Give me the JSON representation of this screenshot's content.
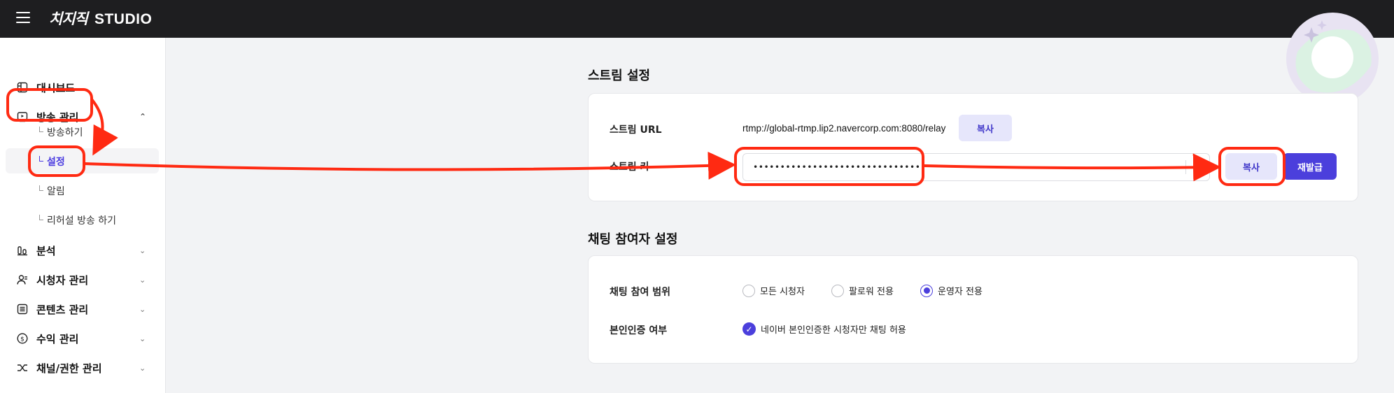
{
  "header": {
    "logo_mark": "치지직",
    "logo_text": "STUDIO"
  },
  "sidebar": {
    "dashboard": "대시보드",
    "broadcast": "방송 관리",
    "sub": [
      "방송하기",
      "설정",
      "알림",
      "리허설 방송 하기"
    ],
    "analytics": "분석",
    "viewers": "시청자 관리",
    "contents": "콘텐츠 관리",
    "revenue": "수익 관리",
    "channel": "채널/권한 관리"
  },
  "stream": {
    "title": "스트림 설정",
    "url_label": "스트림 URL",
    "url_value": "rtmp://global-rtmp.lip2.navercorp.com:8080/relay",
    "copy_label": "복사",
    "key_label": "스트림 키",
    "key_value": "••••••••••••••••••••••••••••••••",
    "copy_key_label": "복사",
    "reissue_label": "재발급"
  },
  "chat": {
    "title": "채팅 참여자 설정",
    "range_label": "채팅 참여 범위",
    "options": [
      "모든 시청자",
      "팔로워 전용",
      "운영자 전용"
    ],
    "selected": "운영자 전용",
    "verify_label": "본인인증 여부",
    "verify_option": "네이버 본인인증한 시청자만 채팅 허용",
    "verify_checked": true
  },
  "colors": {
    "accent": "#4b3fdc",
    "annotation": "#ff2a12",
    "header_bg": "#1e1e20"
  }
}
